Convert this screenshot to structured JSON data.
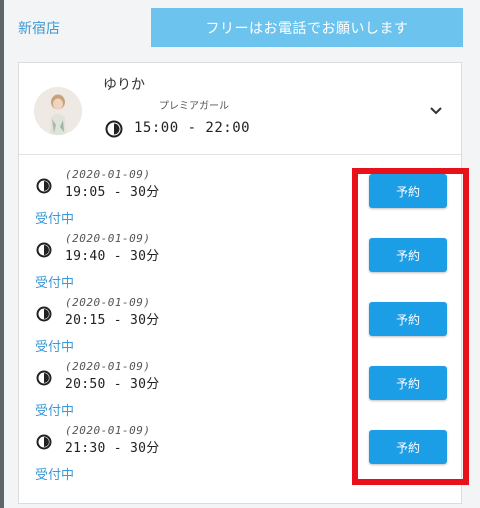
{
  "header": {
    "store_name": "新宿店",
    "phone_banner": "フリーはお電話でお願いします"
  },
  "profile": {
    "name": "ゆりか",
    "rank": "プレミアガール",
    "shift": "15:00 - 22:00"
  },
  "slots": [
    {
      "date": "(2020-01-09)",
      "time": "19:05 - 30分",
      "status": "受付中",
      "button": "予約"
    },
    {
      "date": "(2020-01-09)",
      "time": "19:40 - 30分",
      "status": "受付中",
      "button": "予約"
    },
    {
      "date": "(2020-01-09)",
      "time": "20:15 - 30分",
      "status": "受付中",
      "button": "予約"
    },
    {
      "date": "(2020-01-09)",
      "time": "20:50 - 30分",
      "status": "受付中",
      "button": "予約"
    },
    {
      "date": "(2020-01-09)",
      "time": "21:30 - 30分",
      "status": "受付中",
      "button": "予約"
    }
  ],
  "colors": {
    "accent": "#3b9ad3",
    "button": "#1b9ee6",
    "banner": "#6cc4ee",
    "highlight": "#e8101a"
  },
  "icons": {
    "clock": "clock-icon",
    "expand": "chevron-down-icon"
  }
}
